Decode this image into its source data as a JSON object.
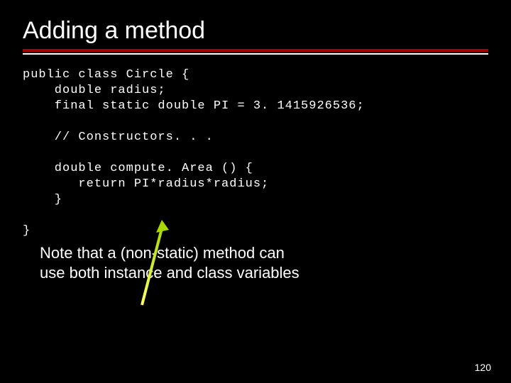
{
  "title": "Adding a method",
  "code": {
    "line1": "public class Circle {",
    "line2": "    double radius;",
    "line3": "    final static double PI = 3. 1415926536;",
    "blank1": "",
    "line4": "    // Constructors. . .",
    "blank2": "",
    "line5": "    double compute. Area () {",
    "line6": "       return PI*radius*radius;",
    "line7": "    }",
    "blank3": "",
    "line8": "}"
  },
  "note_line1": "Note that a (non-static) method can",
  "note_line2": "use both instance and class variables",
  "page_number": "120"
}
